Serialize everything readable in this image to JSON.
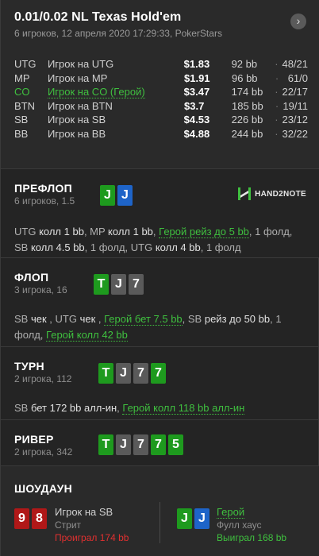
{
  "header": {
    "title": "0.01/0.02 NL Texas Hold'em",
    "subtitle": "6 игроков, 12 апреля 2020 17:29:33, PokerStars",
    "nav_icon": "›"
  },
  "players": [
    {
      "pos": "UTG",
      "name": "Игрок на UTG",
      "stack": "$1.83",
      "bb": "92 bb",
      "dot": "·",
      "stat": "48/21",
      "hero": false
    },
    {
      "pos": "MP",
      "name": "Игрок на MP",
      "stack": "$1.91",
      "bb": "96 bb",
      "dot": "·",
      "stat": "61/0",
      "hero": false
    },
    {
      "pos": "CO",
      "name": "Игрок на CO (Герой)",
      "stack": "$3.47",
      "bb": "174 bb",
      "dot": "·",
      "stat": "22/17",
      "hero": true
    },
    {
      "pos": "BTN",
      "name": "Игрок на BTN",
      "stack": "$3.7",
      "bb": "185 bb",
      "dot": "·",
      "stat": "19/11",
      "hero": false
    },
    {
      "pos": "SB",
      "name": "Игрок на SB",
      "stack": "$4.53",
      "bb": "226 bb",
      "dot": "·",
      "stat": "23/12",
      "hero": false
    },
    {
      "pos": "BB",
      "name": "Игрок на BB",
      "stack": "$4.88",
      "bb": "244 bb",
      "dot": "·",
      "stat": "32/22",
      "hero": false
    }
  ],
  "logo": {
    "text": "HAND2NOTE"
  },
  "preflop": {
    "title": "ПРЕФЛОП",
    "sub": "6 игроков, 1.5",
    "cards": [
      {
        "r": "J",
        "c": "green"
      },
      {
        "r": "J",
        "c": "blue"
      }
    ],
    "actions": [
      {
        "t": "UTG",
        "k": "m"
      },
      {
        "t": " колл 1 bb",
        "k": "n"
      },
      {
        "t": ", ",
        "k": "m"
      },
      {
        "t": "MP",
        "k": "m"
      },
      {
        "t": " колл 1 bb",
        "k": "n"
      },
      {
        "t": ", ",
        "k": "m"
      },
      {
        "t": "Герой рейз до 5 bb",
        "k": "h"
      },
      {
        "t": ", 1 фолд, ",
        "k": "m"
      },
      {
        "t": "SB",
        "k": "m"
      },
      {
        "t": " колл 4.5 bb",
        "k": "n"
      },
      {
        "t": ", 1 фолд, ",
        "k": "m"
      },
      {
        "t": "UTG",
        "k": "m"
      },
      {
        "t": " колл 4 bb",
        "k": "n"
      },
      {
        "t": ", 1 фолд",
        "k": "m"
      }
    ]
  },
  "flop": {
    "title": "ФЛОП",
    "sub": "3 игрока, 16",
    "cards": [
      {
        "r": "T",
        "c": "green"
      },
      {
        "r": "J",
        "c": "gray"
      },
      {
        "r": "7",
        "c": "gray"
      }
    ],
    "actions": [
      {
        "t": "SB",
        "k": "m"
      },
      {
        "t": " чек",
        "k": "n"
      },
      {
        "t": " , ",
        "k": "m"
      },
      {
        "t": "UTG",
        "k": "m"
      },
      {
        "t": " чек",
        "k": "n"
      },
      {
        "t": " , ",
        "k": "m"
      },
      {
        "t": "Герой бет 7.5 bb",
        "k": "h"
      },
      {
        "t": ", ",
        "k": "m"
      },
      {
        "t": "SB",
        "k": "m"
      },
      {
        "t": " рейз до 50 bb",
        "k": "n"
      },
      {
        "t": ", 1 фолд, ",
        "k": "m"
      },
      {
        "t": "Герой колл 42 bb",
        "k": "h"
      }
    ]
  },
  "turn": {
    "title": "ТУРН",
    "sub": "2 игрока, 112",
    "cards": [
      {
        "r": "T",
        "c": "green"
      },
      {
        "r": "J",
        "c": "gray"
      },
      {
        "r": "7",
        "c": "gray"
      },
      {
        "r": "7",
        "c": "green"
      }
    ],
    "actions": [
      {
        "t": "SB",
        "k": "m"
      },
      {
        "t": " бет 172 bb алл-ин",
        "k": "n"
      },
      {
        "t": ", ",
        "k": "m"
      },
      {
        "t": "Герой колл 118 bb алл-ин",
        "k": "h"
      }
    ]
  },
  "river": {
    "title": "РИВЕР",
    "sub": "2 игрока, 342",
    "cards": [
      {
        "r": "T",
        "c": "green"
      },
      {
        "r": "J",
        "c": "gray"
      },
      {
        "r": "7",
        "c": "gray"
      },
      {
        "r": "7",
        "c": "green"
      },
      {
        "r": "5",
        "c": "green"
      }
    ]
  },
  "showdown": {
    "title": "ШОУДАУН",
    "left": {
      "cards": [
        {
          "r": "9",
          "c": "red"
        },
        {
          "r": "8",
          "c": "red"
        }
      ],
      "name": "Игрок на SB",
      "hand": "Стрит",
      "result": "Проиграл 174 bb"
    },
    "right": {
      "cards": [
        {
          "r": "J",
          "c": "green"
        },
        {
          "r": "J",
          "c": "blue"
        }
      ],
      "name": "Герой",
      "hand": "Фулл хаус",
      "result": "Выиграл 168 bb"
    }
  }
}
